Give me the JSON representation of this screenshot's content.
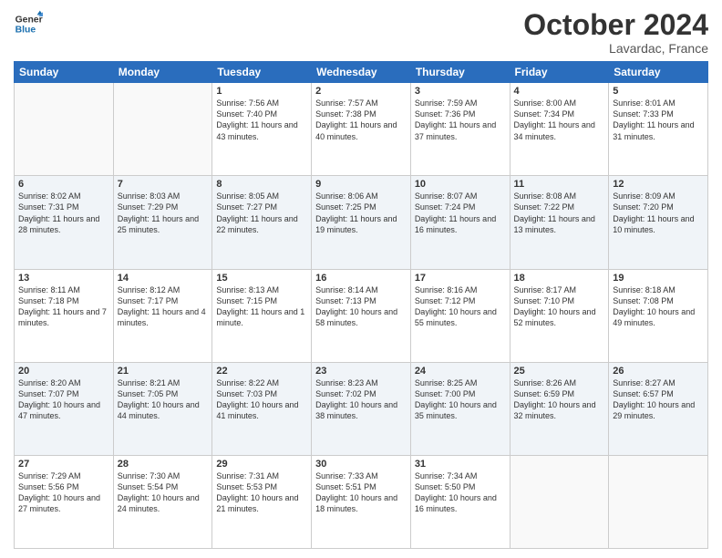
{
  "header": {
    "logo_general": "General",
    "logo_blue": "Blue",
    "month": "October 2024",
    "location": "Lavardac, France"
  },
  "days_of_week": [
    "Sunday",
    "Monday",
    "Tuesday",
    "Wednesday",
    "Thursday",
    "Friday",
    "Saturday"
  ],
  "weeks": [
    [
      {
        "day": "",
        "sunrise": "",
        "sunset": "",
        "daylight": ""
      },
      {
        "day": "",
        "sunrise": "",
        "sunset": "",
        "daylight": ""
      },
      {
        "day": "1",
        "sunrise": "Sunrise: 7:56 AM",
        "sunset": "Sunset: 7:40 PM",
        "daylight": "Daylight: 11 hours and 43 minutes."
      },
      {
        "day": "2",
        "sunrise": "Sunrise: 7:57 AM",
        "sunset": "Sunset: 7:38 PM",
        "daylight": "Daylight: 11 hours and 40 minutes."
      },
      {
        "day": "3",
        "sunrise": "Sunrise: 7:59 AM",
        "sunset": "Sunset: 7:36 PM",
        "daylight": "Daylight: 11 hours and 37 minutes."
      },
      {
        "day": "4",
        "sunrise": "Sunrise: 8:00 AM",
        "sunset": "Sunset: 7:34 PM",
        "daylight": "Daylight: 11 hours and 34 minutes."
      },
      {
        "day": "5",
        "sunrise": "Sunrise: 8:01 AM",
        "sunset": "Sunset: 7:33 PM",
        "daylight": "Daylight: 11 hours and 31 minutes."
      }
    ],
    [
      {
        "day": "6",
        "sunrise": "Sunrise: 8:02 AM",
        "sunset": "Sunset: 7:31 PM",
        "daylight": "Daylight: 11 hours and 28 minutes."
      },
      {
        "day": "7",
        "sunrise": "Sunrise: 8:03 AM",
        "sunset": "Sunset: 7:29 PM",
        "daylight": "Daylight: 11 hours and 25 minutes."
      },
      {
        "day": "8",
        "sunrise": "Sunrise: 8:05 AM",
        "sunset": "Sunset: 7:27 PM",
        "daylight": "Daylight: 11 hours and 22 minutes."
      },
      {
        "day": "9",
        "sunrise": "Sunrise: 8:06 AM",
        "sunset": "Sunset: 7:25 PM",
        "daylight": "Daylight: 11 hours and 19 minutes."
      },
      {
        "day": "10",
        "sunrise": "Sunrise: 8:07 AM",
        "sunset": "Sunset: 7:24 PM",
        "daylight": "Daylight: 11 hours and 16 minutes."
      },
      {
        "day": "11",
        "sunrise": "Sunrise: 8:08 AM",
        "sunset": "Sunset: 7:22 PM",
        "daylight": "Daylight: 11 hours and 13 minutes."
      },
      {
        "day": "12",
        "sunrise": "Sunrise: 8:09 AM",
        "sunset": "Sunset: 7:20 PM",
        "daylight": "Daylight: 11 hours and 10 minutes."
      }
    ],
    [
      {
        "day": "13",
        "sunrise": "Sunrise: 8:11 AM",
        "sunset": "Sunset: 7:18 PM",
        "daylight": "Daylight: 11 hours and 7 minutes."
      },
      {
        "day": "14",
        "sunrise": "Sunrise: 8:12 AM",
        "sunset": "Sunset: 7:17 PM",
        "daylight": "Daylight: 11 hours and 4 minutes."
      },
      {
        "day": "15",
        "sunrise": "Sunrise: 8:13 AM",
        "sunset": "Sunset: 7:15 PM",
        "daylight": "Daylight: 11 hours and 1 minute."
      },
      {
        "day": "16",
        "sunrise": "Sunrise: 8:14 AM",
        "sunset": "Sunset: 7:13 PM",
        "daylight": "Daylight: 10 hours and 58 minutes."
      },
      {
        "day": "17",
        "sunrise": "Sunrise: 8:16 AM",
        "sunset": "Sunset: 7:12 PM",
        "daylight": "Daylight: 10 hours and 55 minutes."
      },
      {
        "day": "18",
        "sunrise": "Sunrise: 8:17 AM",
        "sunset": "Sunset: 7:10 PM",
        "daylight": "Daylight: 10 hours and 52 minutes."
      },
      {
        "day": "19",
        "sunrise": "Sunrise: 8:18 AM",
        "sunset": "Sunset: 7:08 PM",
        "daylight": "Daylight: 10 hours and 49 minutes."
      }
    ],
    [
      {
        "day": "20",
        "sunrise": "Sunrise: 8:20 AM",
        "sunset": "Sunset: 7:07 PM",
        "daylight": "Daylight: 10 hours and 47 minutes."
      },
      {
        "day": "21",
        "sunrise": "Sunrise: 8:21 AM",
        "sunset": "Sunset: 7:05 PM",
        "daylight": "Daylight: 10 hours and 44 minutes."
      },
      {
        "day": "22",
        "sunrise": "Sunrise: 8:22 AM",
        "sunset": "Sunset: 7:03 PM",
        "daylight": "Daylight: 10 hours and 41 minutes."
      },
      {
        "day": "23",
        "sunrise": "Sunrise: 8:23 AM",
        "sunset": "Sunset: 7:02 PM",
        "daylight": "Daylight: 10 hours and 38 minutes."
      },
      {
        "day": "24",
        "sunrise": "Sunrise: 8:25 AM",
        "sunset": "Sunset: 7:00 PM",
        "daylight": "Daylight: 10 hours and 35 minutes."
      },
      {
        "day": "25",
        "sunrise": "Sunrise: 8:26 AM",
        "sunset": "Sunset: 6:59 PM",
        "daylight": "Daylight: 10 hours and 32 minutes."
      },
      {
        "day": "26",
        "sunrise": "Sunrise: 8:27 AM",
        "sunset": "Sunset: 6:57 PM",
        "daylight": "Daylight: 10 hours and 29 minutes."
      }
    ],
    [
      {
        "day": "27",
        "sunrise": "Sunrise: 7:29 AM",
        "sunset": "Sunset: 5:56 PM",
        "daylight": "Daylight: 10 hours and 27 minutes."
      },
      {
        "day": "28",
        "sunrise": "Sunrise: 7:30 AM",
        "sunset": "Sunset: 5:54 PM",
        "daylight": "Daylight: 10 hours and 24 minutes."
      },
      {
        "day": "29",
        "sunrise": "Sunrise: 7:31 AM",
        "sunset": "Sunset: 5:53 PM",
        "daylight": "Daylight: 10 hours and 21 minutes."
      },
      {
        "day": "30",
        "sunrise": "Sunrise: 7:33 AM",
        "sunset": "Sunset: 5:51 PM",
        "daylight": "Daylight: 10 hours and 18 minutes."
      },
      {
        "day": "31",
        "sunrise": "Sunrise: 7:34 AM",
        "sunset": "Sunset: 5:50 PM",
        "daylight": "Daylight: 10 hours and 16 minutes."
      },
      {
        "day": "",
        "sunrise": "",
        "sunset": "",
        "daylight": ""
      },
      {
        "day": "",
        "sunrise": "",
        "sunset": "",
        "daylight": ""
      }
    ]
  ]
}
